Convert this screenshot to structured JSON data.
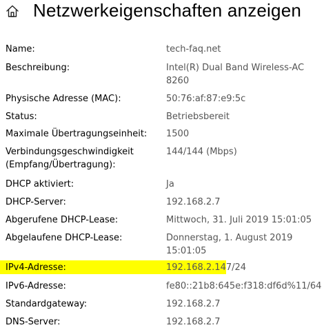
{
  "header": {
    "title": "Netzwerkeigenschaften anzeigen",
    "icon": "home-icon"
  },
  "properties": [
    {
      "label": "Name:",
      "value": "tech-faq.net"
    },
    {
      "label": "Beschreibung:",
      "value": "Intel(R) Dual Band Wireless-AC 8260"
    },
    {
      "label": "Physische Adresse (MAC):",
      "value": "50:76:af:87:e9:5c"
    },
    {
      "label": "Status:",
      "value": "Betriebsbereit"
    },
    {
      "label": "Maximale Übertragungseinheit:",
      "value": "1500"
    },
    {
      "label": "Verbindungsgeschwindigkeit (Empfang/Übertragung):",
      "value": "144/144 (Mbps)"
    },
    {
      "label": "DHCP aktiviert:",
      "value": "Ja"
    },
    {
      "label": "DHCP-Server:",
      "value": "192.168.2.7"
    },
    {
      "label": "Abgerufene DHCP-Lease:",
      "value": "Mittwoch, 31. Juli 2019 15:01:05"
    },
    {
      "label": "Abgelaufene DHCP-Lease:",
      "value": "Donnerstag, 1. August 2019 15:01:05"
    },
    {
      "label": "IPv4-Adresse:",
      "value_main": "192.168.2.147",
      "value_suffix": "/24"
    },
    {
      "label": "IPv6-Adresse:",
      "value": "fe80::21b8:645e:f318:df6d%11/64"
    },
    {
      "label": "Standardgateway:",
      "value": "192.168.2.7"
    },
    {
      "label": "DNS-Server:",
      "value": "192.168.2.7"
    }
  ],
  "highlight_color": "#ffff00"
}
